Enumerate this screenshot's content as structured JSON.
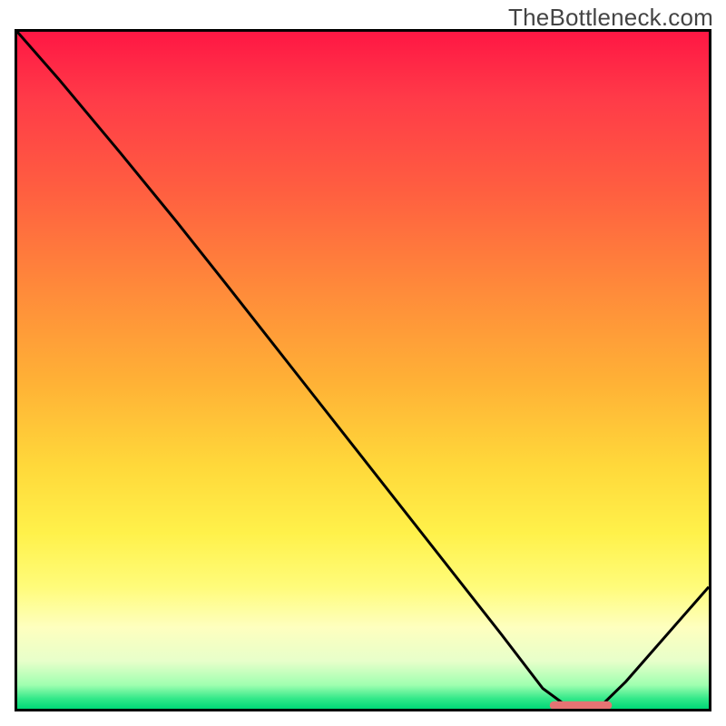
{
  "watermark": "TheBottleneck.com",
  "chart_data": {
    "type": "line",
    "title": "",
    "xlabel": "",
    "ylabel": "",
    "xlim": [
      0,
      100
    ],
    "ylim": [
      0,
      100
    ],
    "background_gradient": {
      "top_color": "#ff1744",
      "mid_color": "#ffd83a",
      "bottom_color": "#00d877"
    },
    "series": [
      {
        "name": "bottleneck-curve",
        "color": "#000000",
        "x": [
          0,
          6,
          15,
          23,
          30,
          40,
          50,
          60,
          70,
          76,
          80,
          84,
          88,
          100
        ],
        "y": [
          100,
          93,
          82,
          72,
          63,
          50,
          37,
          24,
          11,
          3,
          0,
          0,
          4,
          18
        ]
      }
    ],
    "marker": {
      "name": "optimal-range",
      "color": "#e57373",
      "x_start": 77,
      "x_end": 86,
      "y": 0.5,
      "thickness_y": 1.2
    }
  }
}
